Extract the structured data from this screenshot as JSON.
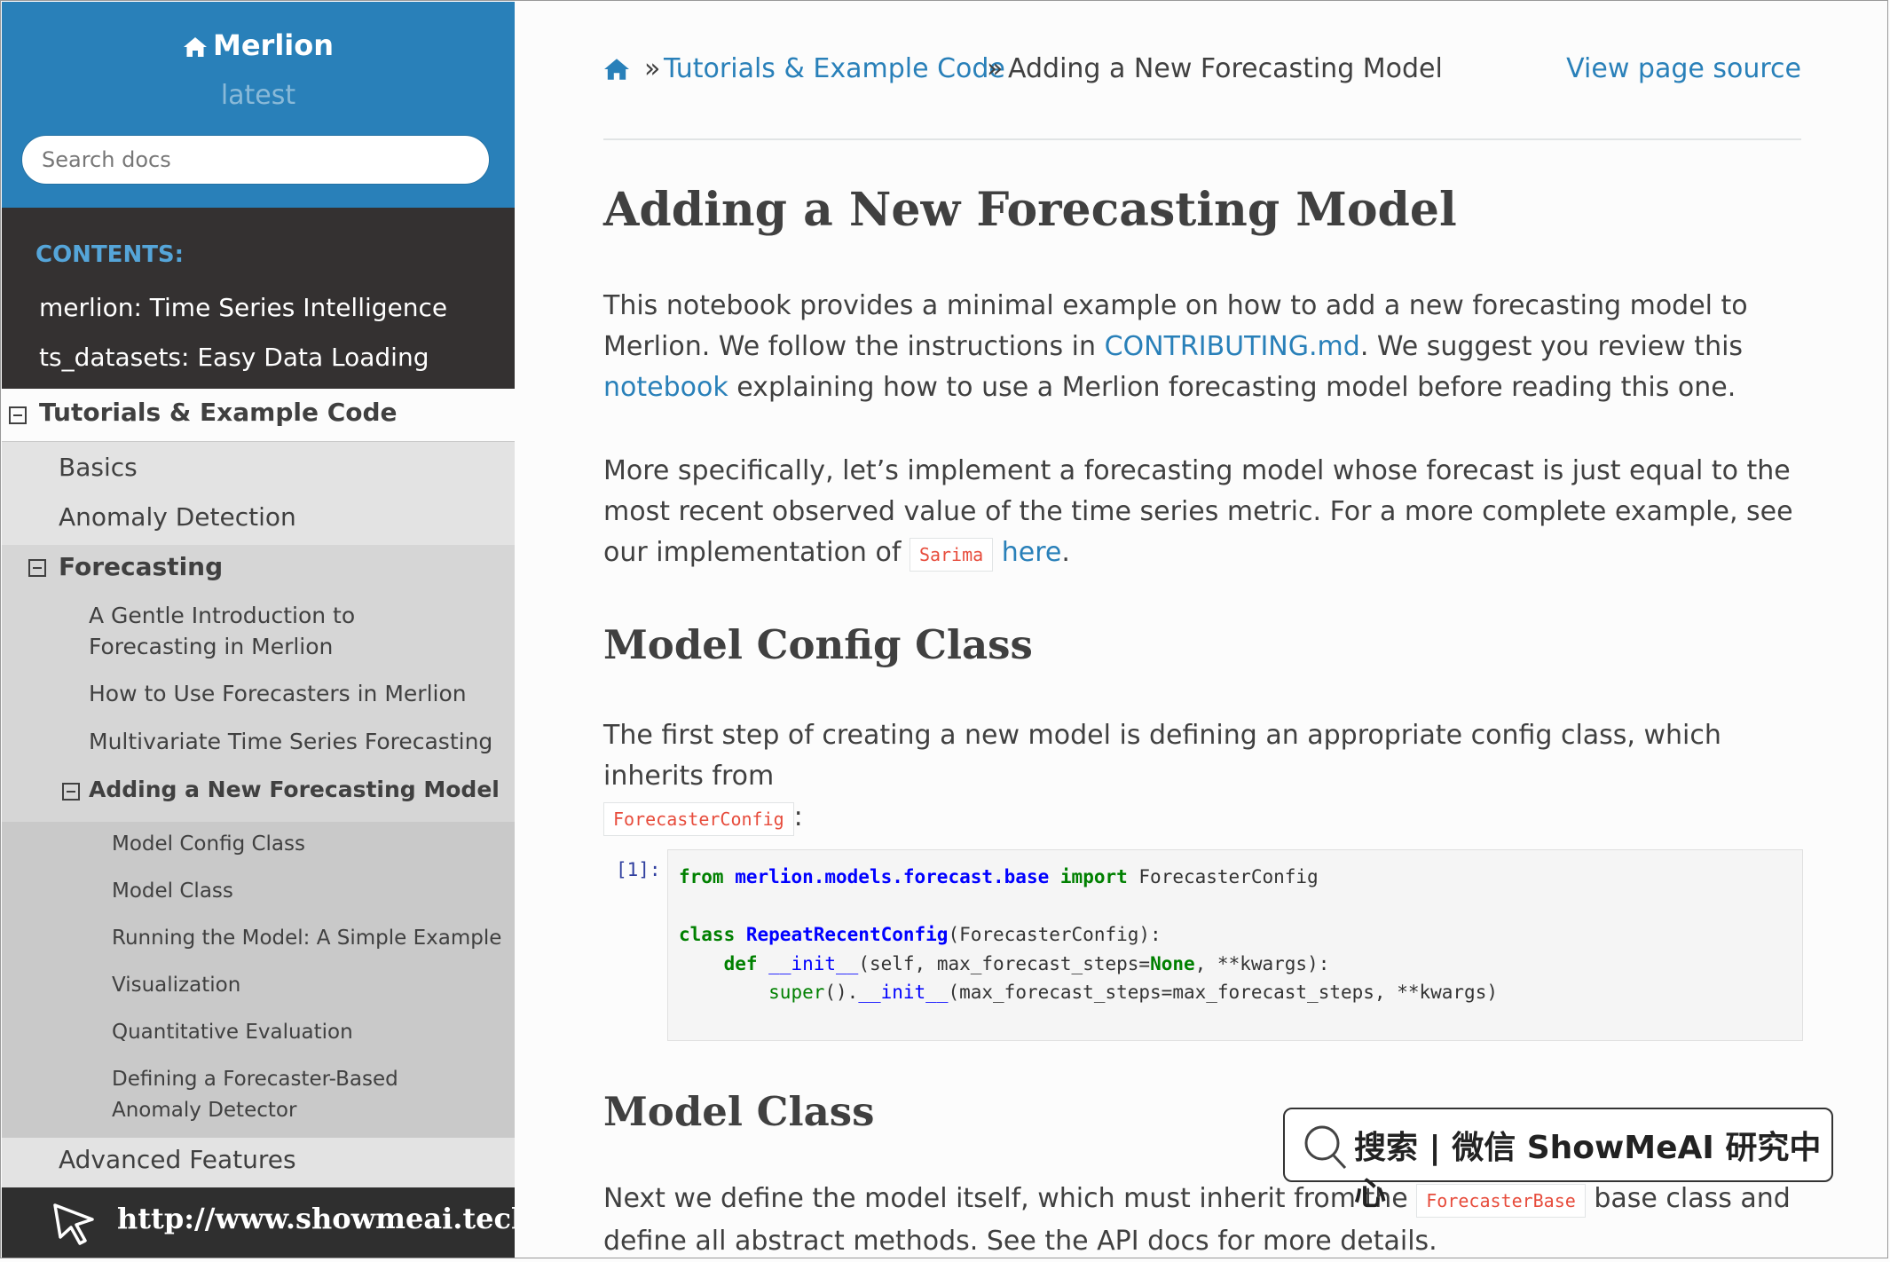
{
  "sidebar": {
    "project": "Merlion",
    "version": "latest",
    "search_placeholder": "Search docs",
    "caption": "CONTENTS:",
    "top_items": [
      "merlion: Time Series Intelligence",
      "ts_datasets: Easy Data Loading"
    ],
    "current_l1": "Tutorials & Example Code",
    "l2_items": [
      "Basics",
      "Anomaly Detection"
    ],
    "forecasting": "Forecasting",
    "l3_items": [
      "A Gentle Introduction to Forecasting in Merlion",
      "How to Use Forecasters in Merlion",
      "Multivariate Time Series Forecasting"
    ],
    "current_l3": "Adding a New Forecasting Model",
    "l4_items": [
      "Model Config Class",
      "Model Class",
      "Running the Model: A Simple Example",
      "Visualization",
      "Quantitative Evaluation",
      "Defining a Forecaster-Based Anomaly Detector"
    ],
    "advanced": "Advanced Features",
    "footer_url": "http://www.showmeai.tech/"
  },
  "breadcrumb": {
    "sep": "»",
    "section": "Tutorials & Example Code",
    "current": "Adding a New Forecasting Model",
    "source_link": "View page source"
  },
  "content": {
    "title": "Adding a New Forecasting Model",
    "p1_a": "This notebook provides a minimal example on how to add a new forecasting model to Merlion. We follow the instructions in ",
    "p1_link1": "CONTRIBUTING.md",
    "p1_b": ". We suggest you review this ",
    "p1_link2": "notebook",
    "p1_c": " explaining how to use a Merlion forecasting model before reading this one.",
    "p2_a": "More specifically, let’s implement a forecasting model whose forecast is just equal to the most recent observed value of the time series metric. For a more complete example, see our implementation of ",
    "p2_code": "Sarima",
    "p2_link": "here",
    "p2_b": ".",
    "h2_config": "Model Config Class",
    "p3_a": "The first step of creating a new model is defining an appropriate config class, which inherits from ",
    "p3_code": "ForecasterConfig",
    "p3_b": ":",
    "prompt": "[1]:",
    "h2_model": "Model Class",
    "p4_a": "Next we define the model itself, which must inherit from the ",
    "p4_code": "ForecasterBase",
    "p4_b": " base class and define all abstract methods. See the API docs for more details."
  },
  "code": {
    "l1_kw_from": "from",
    "l1_mod": "merlion.models.forecast.base",
    "l1_kw_import": "import",
    "l1_name": " ForecasterConfig",
    "l3_kw_class": "class",
    "l3_cls": "RepeatRecentConfig",
    "l3_rest": "(ForecasterConfig):",
    "l4_kw_def": "def",
    "l4_fn": "__init__",
    "l4_a": "(self, max_forecast_steps=",
    "l4_none": "None",
    "l4_b": ", **kwargs):",
    "l5_super": "super",
    "l5_a": "().",
    "l5_fn": "__init__",
    "l5_b": "(max_forecast_steps=max_forecast_steps, **kwargs)"
  },
  "watermark": "搜索 | 微信  ShowMeAI 研究中心",
  "colors": {
    "sidebar_header": "#2980b9",
    "sidebar_bg": "#343131",
    "link": "#2980b9",
    "code_literal": "#e74c3c"
  }
}
